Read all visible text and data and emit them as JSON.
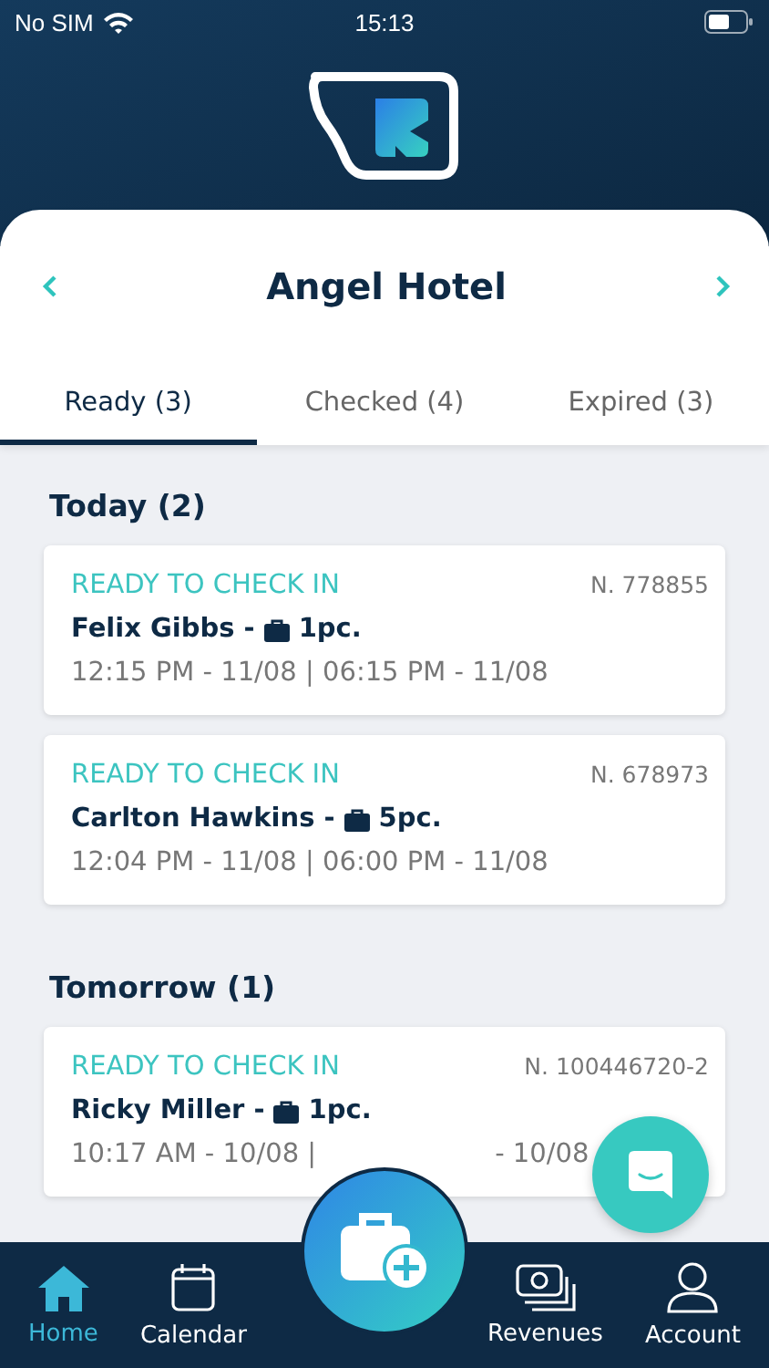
{
  "status_bar": {
    "carrier": "No SIM",
    "time": "15:13"
  },
  "hotel": {
    "name": "Angel Hotel"
  },
  "tabs": [
    {
      "label": "Ready (3)",
      "selected": true
    },
    {
      "label": "Checked (4)",
      "selected": false
    },
    {
      "label": "Expired (3)",
      "selected": false
    }
  ],
  "sections": [
    {
      "title": "Today (2)",
      "bookings": [
        {
          "status": "READY TO CHECK IN",
          "number": "N. 778855",
          "guest": "Felix Gibbs -",
          "bags": "1pc.",
          "times": [
            "12:15 PM - 11/08 | 06:15 PM - 11/08"
          ]
        },
        {
          "status": "READY TO CHECK IN",
          "number": "N. 678973",
          "guest": "Carlton Hawkins -",
          "bags": "5pc.",
          "times": [
            "12:04 PM - 11/08 | 06:00 PM - 11/08"
          ]
        }
      ]
    },
    {
      "title": "Tomorrow (1)",
      "bookings": [
        {
          "status": "READY TO CHECK IN",
          "number": "N. 100446720-2",
          "guest": "Ricky Miller -",
          "bags": "1pc.",
          "times": [
            "10:17 AM - 10/08 |",
            "- 10/08"
          ]
        }
      ]
    }
  ],
  "nav": [
    {
      "label": "Home",
      "kind": "home",
      "selected": true
    },
    {
      "label": "Calendar",
      "kind": "calendar",
      "selected": false
    },
    {
      "label": "Revenues",
      "kind": "revenues",
      "selected": false
    },
    {
      "label": "Account",
      "kind": "account",
      "selected": false
    }
  ]
}
